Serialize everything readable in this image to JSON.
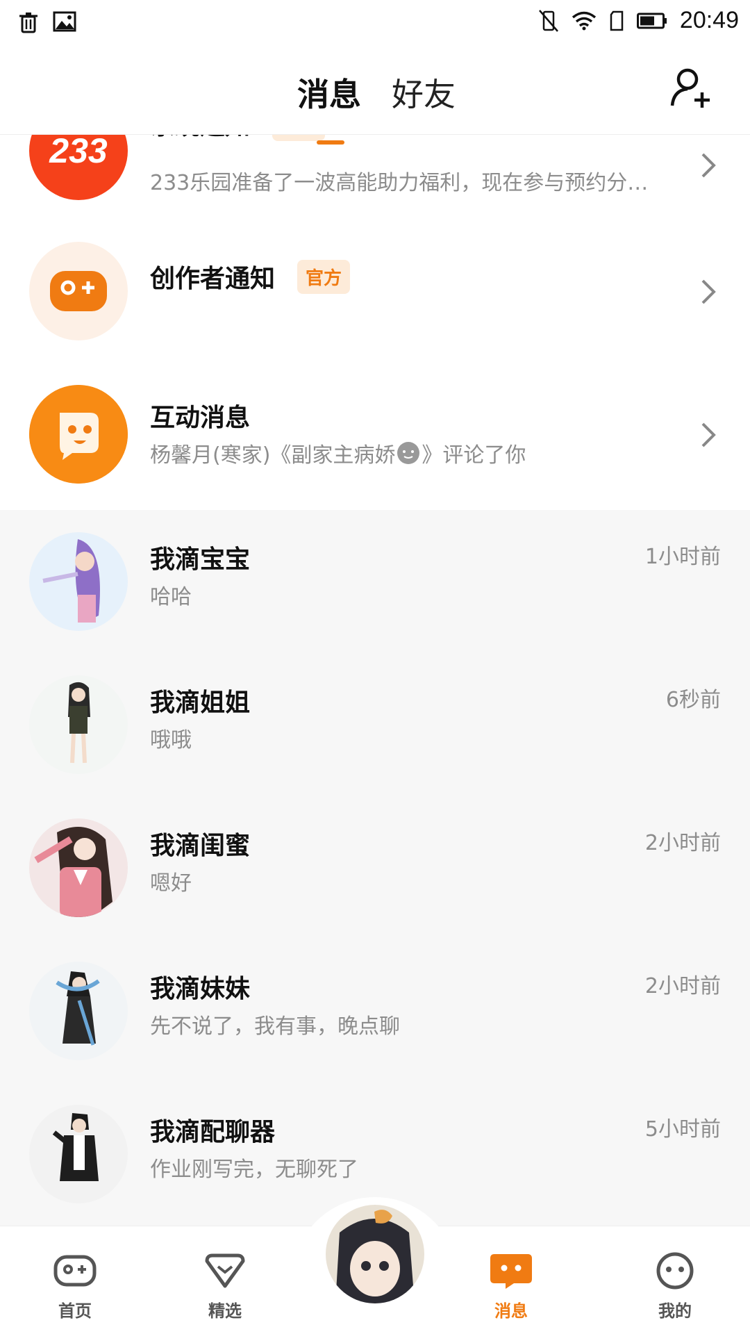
{
  "status_bar": {
    "time": "20:49",
    "left_icons": [
      "trash-icon",
      "image-icon"
    ],
    "right_icons": [
      "vibrate-off-icon",
      "wifi-icon",
      "sim-icon",
      "battery-icon"
    ]
  },
  "header": {
    "tabs": [
      {
        "label": "消息",
        "active": true
      },
      {
        "label": "好友",
        "active": false
      }
    ],
    "add_friend_icon": "add-user-icon",
    "accent": "#f07b12"
  },
  "official": [
    {
      "title": "系统通知",
      "badge": "官方",
      "subtitle": "233乐园准备了一波高能助力福利，现在参与预约分…",
      "avatar_text": "233",
      "icon": "logo-233"
    },
    {
      "title": "创作者通知",
      "badge": "官方",
      "subtitle": "",
      "icon": "gamepad-icon"
    },
    {
      "title": "互动消息",
      "subtitle": "杨馨月(寒家)《副家主病娇",
      "subtitle_end": "》评论了你",
      "icon": "chat-bubble-icon"
    }
  ],
  "chats": [
    {
      "name": "我滴宝宝",
      "last_message": "哈哈",
      "time": "1小时前"
    },
    {
      "name": "我滴姐姐",
      "last_message": "哦哦",
      "time": "6秒前"
    },
    {
      "name": "我滴闺蜜",
      "last_message": "嗯好",
      "time": "2小时前"
    },
    {
      "name": "我滴妹妹",
      "last_message": "先不说了，我有事，晚点聊",
      "time": "2小时前"
    },
    {
      "name": "我滴配聊器",
      "last_message": "作业刚写完，无聊死了",
      "time": "5小时前"
    }
  ],
  "bottom_nav": [
    {
      "label": "首页",
      "icon": "gamepad-icon",
      "active": false
    },
    {
      "label": "精选",
      "icon": "heart-tag-icon",
      "active": false
    },
    {
      "label": "消息",
      "icon": "chat-icon",
      "active": true
    },
    {
      "label": "我的",
      "icon": "face-icon",
      "active": false
    }
  ]
}
